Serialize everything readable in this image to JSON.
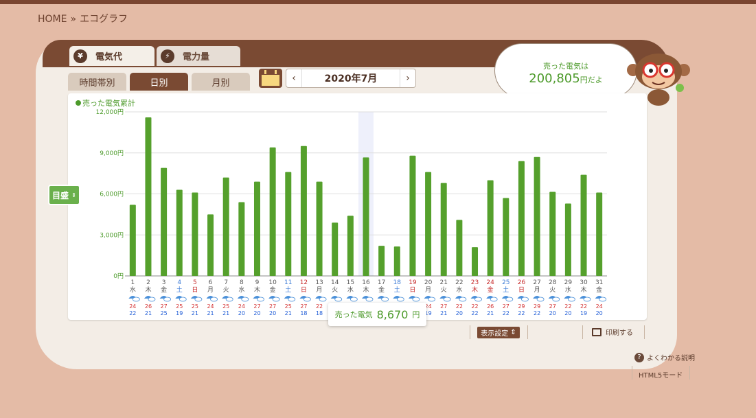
{
  "breadcrumb": {
    "home": "HOME",
    "sep": "»",
    "current": "エコグラフ"
  },
  "tabs": {
    "cost": "電気代",
    "power": "電力量",
    "cost_icon": "¥",
    "power_icon": "⚡"
  },
  "subtabs": {
    "hour": "時間帯別",
    "day": "日別",
    "month": "月別"
  },
  "date_nav": {
    "prev": "‹",
    "label": "2020年7月",
    "next": "›"
  },
  "bubble": {
    "line1": "売った電気は",
    "amount": "200,805",
    "suffix": "円だよ"
  },
  "legend": "売った電気累計",
  "scale_button": "目盛",
  "tooltip": {
    "label": "売った電気",
    "value": "8,670",
    "unit": "円"
  },
  "buttons": {
    "display_settings": "表示設定",
    "print": "印刷する",
    "help": "よくわかる説明",
    "html5": "HTML5モード"
  },
  "chart_data": {
    "type": "bar",
    "ylim": [
      0,
      12000
    ],
    "yticks": [
      "0円",
      "3,000円",
      "6,000円",
      "9,000円",
      "12,000円"
    ],
    "bar_color": "#55a02c",
    "highlight_index": 15,
    "days": [
      "1",
      "2",
      "3",
      "4",
      "5",
      "6",
      "7",
      "8",
      "9",
      "10",
      "11",
      "12",
      "13",
      "14",
      "15",
      "16",
      "17",
      "18",
      "19",
      "20",
      "21",
      "22",
      "23",
      "24",
      "25",
      "26",
      "27",
      "28",
      "29",
      "30",
      "31"
    ],
    "weekdays": [
      "水",
      "木",
      "金",
      "土",
      "日",
      "月",
      "火",
      "水",
      "木",
      "金",
      "土",
      "日",
      "月",
      "火",
      "水",
      "木",
      "金",
      "土",
      "日",
      "月",
      "火",
      "水",
      "木",
      "金",
      "土",
      "日",
      "月",
      "火",
      "水",
      "木",
      "金"
    ],
    "day_colors": [
      "n",
      "n",
      "n",
      "sat",
      "sun",
      "n",
      "n",
      "n",
      "n",
      "n",
      "sat",
      "sun",
      "n",
      "n",
      "n",
      "n",
      "n",
      "sat",
      "sun",
      "n",
      "n",
      "n",
      "hol",
      "hol",
      "sat",
      "sun",
      "n",
      "n",
      "n",
      "n",
      "n"
    ],
    "values": [
      5200,
      11600,
      7900,
      6300,
      6100,
      4500,
      7200,
      5400,
      6900,
      9400,
      7600,
      9500,
      6900,
      3900,
      4400,
      8670,
      2200,
      2150,
      8800,
      7600,
      6800,
      4100,
      2100,
      7000,
      5700,
      8400,
      8700,
      6150,
      5300,
      7400,
      6100
    ],
    "temp_high": [
      "24",
      "26",
      "27",
      "25",
      "25",
      "24",
      "25",
      "24",
      "27",
      "27",
      "25",
      "27",
      "22",
      "",
      "",
      "",
      "",
      "",
      "",
      "24",
      "27",
      "22",
      "22",
      "26",
      "27",
      "29",
      "29",
      "27",
      "22",
      "22",
      "24"
    ],
    "temp_low": [
      "22",
      "21",
      "25",
      "19",
      "21",
      "21",
      "21",
      "20",
      "20",
      "20",
      "21",
      "18",
      "18",
      "",
      "",
      "",
      "",
      "",
      "",
      "19",
      "21",
      "20",
      "22",
      "21",
      "22",
      "22",
      "22",
      "20",
      "20",
      "19",
      "20"
    ]
  }
}
